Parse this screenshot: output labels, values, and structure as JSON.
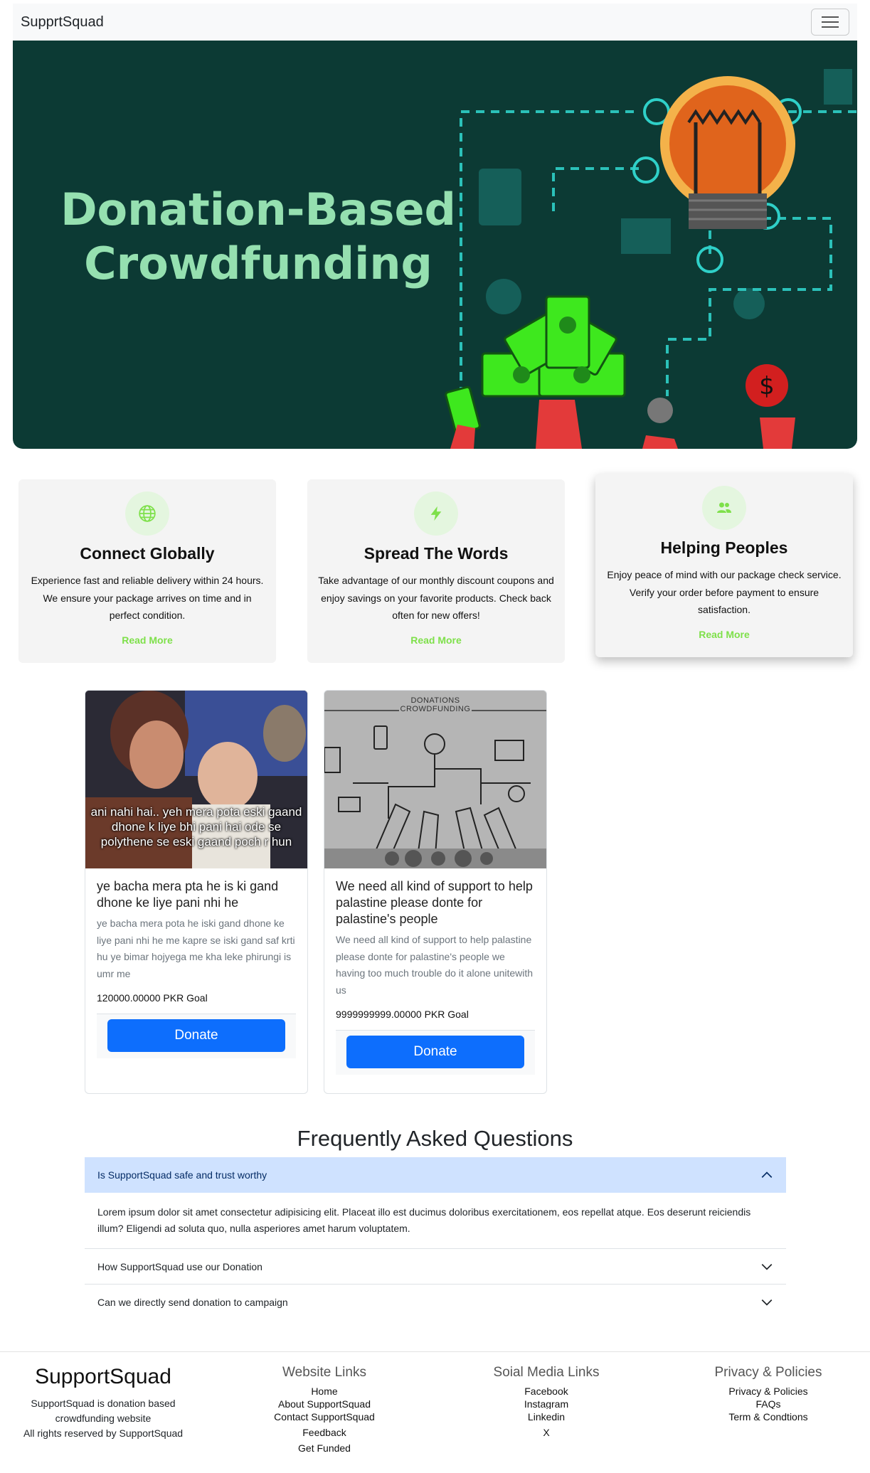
{
  "navbar": {
    "brand": "SupprtSquad"
  },
  "hero": {
    "title_line1": "Donation-Based",
    "title_line2": "Crowdfunding"
  },
  "features": [
    {
      "icon": "globe-icon",
      "title": "Connect Globally",
      "text": "Experience fast and reliable delivery within 24 hours. We ensure your package arrives on time and in perfect condition.",
      "link": "Read More"
    },
    {
      "icon": "lightning-icon",
      "title": "Spread The Words",
      "text": "Take advantage of our monthly discount coupons and enjoy savings on your favorite products. Check back often for new offers!",
      "link": "Read More"
    },
    {
      "icon": "people-icon",
      "title": "Helping Peoples",
      "text": "Enjoy peace of mind with our package check service. Verify your order before payment to ensure satisfaction.",
      "link": "Read More"
    }
  ],
  "campaigns": [
    {
      "image_caption": "ani nahi hai.. yeh mera pota eski gaand dhone k liye bhi pani hai ode se polythene se eski gaand poch r hun",
      "title": "ye bacha mera pta he is ki gand dhone ke liye pani nhi he",
      "text": "ye bacha mera pota he iski gand dhone ke liye pani nhi he me kapre se iski gand saf krti hu ye bimar hojyega me kha leke phirungi is umr me",
      "goal": "120000.00000 PKR Goal",
      "button": "Donate"
    },
    {
      "image_caption": "DONATIONS CROWDFUNDING",
      "title": "We need all kind of support to help palastine please donte for palastine's people",
      "text": "We need all kind of support to help palastine please donte for palastine's people we having too much trouble do it alone unitewith us",
      "goal": "9999999999.00000 PKR Goal",
      "button": "Donate"
    }
  ],
  "faq": {
    "heading": "Frequently Asked Questions",
    "items": [
      {
        "question": "Is SupportSquad safe and trust worthy",
        "answer": "Lorem ipsum dolor sit amet consectetur adipisicing elit. Placeat illo est ducimus doloribus exercitationem, eos repellat atque. Eos deserunt reiciendis illum? Eligendi ad soluta quo, nulla asperiores amet harum voluptatem."
      },
      {
        "question": "How SupportSquad use our Donation"
      },
      {
        "question": "Can we directly send donation to campaign"
      }
    ]
  },
  "footer": {
    "brand": "SupportSquad",
    "desc_line1": "SupportSquad is donation based",
    "desc_line2": "crowdfunding website",
    "rights": "All rights reserved by SupportSquad",
    "website_links": {
      "heading": "Website Links",
      "items": [
        "Home",
        "About SupportSquad",
        "Contact SupportSquad",
        "Feedback",
        "Get Funded"
      ]
    },
    "social_links": {
      "heading": "Soial Media Links",
      "items": [
        "Facebook",
        "Instagram",
        "Linkedin",
        "X"
      ]
    },
    "policies": {
      "heading": "Privacy & Policies",
      "items": [
        "Privacy & Policies",
        "FAQs",
        "Term & Condtions"
      ]
    }
  },
  "colors": {
    "accent_green": "#7ee04a",
    "primary_blue": "#0d6efd",
    "hero_bg": "#0c3a34",
    "hero_title": "#95e0b0"
  }
}
